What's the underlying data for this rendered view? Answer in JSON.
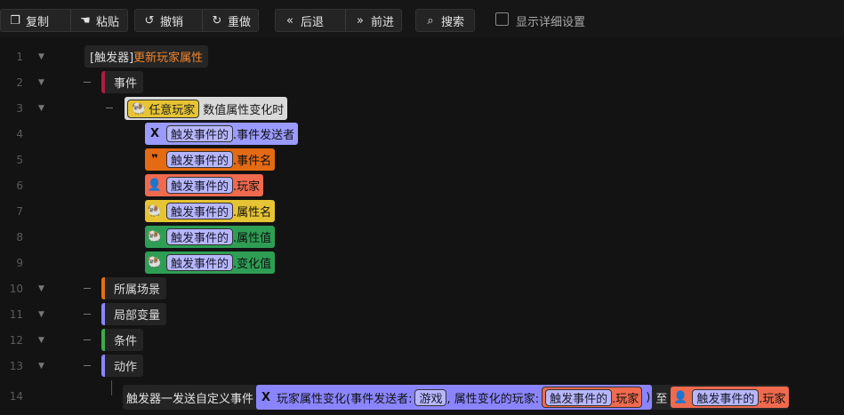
{
  "toolbar": {
    "copy": "复制",
    "paste": "粘贴",
    "undo": "撤销",
    "redo": "重做",
    "back": "后退",
    "forward": "前进",
    "search": "搜索",
    "detail_settings": "显示详细设置"
  },
  "line_numbers": [
    "1",
    "2",
    "3",
    "4",
    "5",
    "6",
    "7",
    "8",
    "9",
    "10",
    "11",
    "12",
    "13",
    "14"
  ],
  "tree": {
    "trigger_prefix": "[触发器]",
    "trigger_name": "更新玩家属性",
    "event_label": "事件",
    "any_player": "任意玩家",
    "event_name": "数值属性变化时",
    "params": [
      {
        "ref": "触发事件的",
        "field": ".事件发送者",
        "icon": "x-icon",
        "color": "#9b9bff"
      },
      {
        "ref": "触发事件的",
        "field": ".事件名",
        "icon": "quote-icon",
        "color": "#e46a14"
      },
      {
        "ref": "触发事件的",
        "field": ".玩家",
        "icon": "user-icon",
        "color": "#ef6a4e"
      },
      {
        "ref": "触发事件的",
        "field": ".属性名",
        "icon": "sheep-icon",
        "color": "#e6c433"
      },
      {
        "ref": "触发事件的",
        "field": ".属性值",
        "icon": "sheep-icon",
        "color": "#2e9e55"
      },
      {
        "ref": "触发事件的",
        "field": ".变化值",
        "icon": "sheep-icon",
        "color": "#2e9e55"
      }
    ],
    "categories": [
      {
        "label": "所属场景",
        "color": "#e07016"
      },
      {
        "label": "局部变量",
        "color": "#8a85ff"
      },
      {
        "label": "条件",
        "color": "#3faa4f"
      },
      {
        "label": "动作",
        "color": "#8a85ff"
      }
    ],
    "action": {
      "prefix": "触发器一发送自定义事件",
      "event_text": "玩家属性变化(事件发送者:",
      "game": "游戏",
      "middle": ", 属性变化的玩家:",
      "ref1": "触发事件的",
      "field1": ".玩家",
      "close": ")",
      "to": "至",
      "ref2": "触发事件的",
      "field2": ".玩家"
    }
  }
}
